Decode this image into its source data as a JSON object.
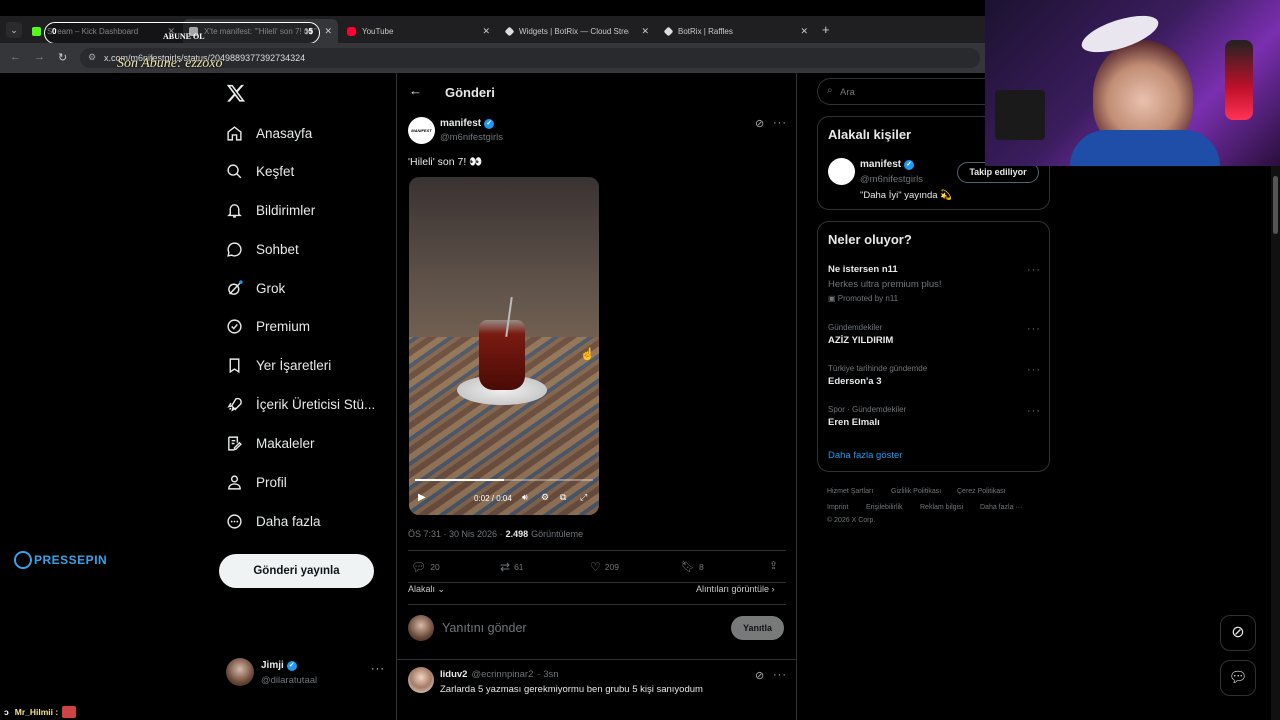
{
  "browser": {
    "tabs": [
      {
        "title": "Stream – Kick Dashboard",
        "fav_color": "#53fc18"
      },
      {
        "title": "X'te manifest: \"'Hileli' son 7! 👀\"",
        "fav_color": "#ffffff"
      },
      {
        "title": "YouTube",
        "fav_color": "#ff0033"
      },
      {
        "title": "Widgets | BotRix — Cloud Stream",
        "fav_color": "#ffffff"
      },
      {
        "title": "BotRix | Raffles",
        "fav_color": "#ffffff"
      }
    ],
    "url": "x.com/m6nifestgirls/status/2049889377392734324",
    "new_tab": "+"
  },
  "overlay": {
    "sub_goal_label": "ABUNE OL",
    "sub_goal_current": "0",
    "sub_goal_target": "5",
    "last_sub_text": "Son Abune: ezzoxo",
    "sponsor_logo": "PRESSEPIN",
    "chat_line_user": "Mr_Hilmii :",
    "chat_prefix": "ↄ"
  },
  "sidebar": {
    "items": [
      {
        "label": "Anasayfa",
        "icon": "home-icon"
      },
      {
        "label": "Keşfet",
        "icon": "search-icon"
      },
      {
        "label": "Bildirimler",
        "icon": "bell-icon"
      },
      {
        "label": "Sohbet",
        "icon": "chat-icon"
      },
      {
        "label": "Grok",
        "icon": "grok-icon"
      },
      {
        "label": "Premium",
        "icon": "premium-icon"
      },
      {
        "label": "Yer İşaretleri",
        "icon": "bookmark-icon"
      },
      {
        "label": "İçerik Üreticisi Stü...",
        "icon": "rocket-icon"
      },
      {
        "label": "Makaleler",
        "icon": "article-icon"
      },
      {
        "label": "Profil",
        "icon": "profile-icon"
      },
      {
        "label": "Daha fazla",
        "icon": "more-circle-icon"
      }
    ],
    "post_button": "Gönderi yayınla",
    "account": {
      "name": "Jimji",
      "handle": "@dilaratutaal"
    }
  },
  "post": {
    "header_title": "Gönderi",
    "author": {
      "name": "manifest",
      "handle": "@m6nifestgirls",
      "avatar_text": "MANIFEST"
    },
    "text": "'Hileli' son 7! 👀",
    "video": {
      "time": "0:02 / 0:04",
      "progress": 0.5
    },
    "meta_time": "ÖS 7:31 · 30 Nis 2026 ·",
    "views_count": "2.498",
    "views_label": "Görüntüleme",
    "stats": {
      "replies": "20",
      "reposts": "61",
      "likes": "209",
      "bookmarks": "8"
    },
    "sort_label": "Alakalı",
    "quotes_label": "Alıntıları görüntüle",
    "reply_placeholder": "Yanıtını gönder",
    "reply_button": "Yanıtla"
  },
  "reply": {
    "name": "liduv2",
    "handle": "@ecrinnpinar2",
    "time": "· 3sn",
    "text": "Zarlarda 5 yazması gerekmiyormu ben grubu 5 kişi sanıyodum"
  },
  "right": {
    "search_placeholder": "Ara",
    "related_title": "Alakalı kişiler",
    "related": {
      "name": "manifest",
      "handle": "@m6nifestgirls",
      "bio": "\"Daha İyi\" yayında 💫",
      "button": "Takip ediliyor"
    },
    "trends_title": "Neler oluyor?",
    "trends": [
      {
        "context": "",
        "title": "Ne istersen n11",
        "sub": "Herkes ultra premium plus!",
        "promo": "Promoted by n11"
      },
      {
        "context": "Gündemdekiler",
        "title": "AZİZ YILDIRIM"
      },
      {
        "context": "Türkiye tarihinde gündemde",
        "title": "Ederson'a 3"
      },
      {
        "context": "Spor · Gündemdekiler",
        "title": "Eren Elmalı"
      }
    ],
    "show_more": "Daha fazla göster",
    "footer": [
      "Hizmet Şartları",
      "Gizlilik Politikası",
      "Çerez Politikası",
      "Imprint",
      "Erişilebilirlik",
      "Reklam bilgisi",
      "Daha fazla ···",
      "© 2026 X Corp."
    ]
  },
  "colors": {
    "accent": "#1d9bf0",
    "bg": "#000000",
    "border": "#2f3336",
    "muted": "#71767b"
  }
}
